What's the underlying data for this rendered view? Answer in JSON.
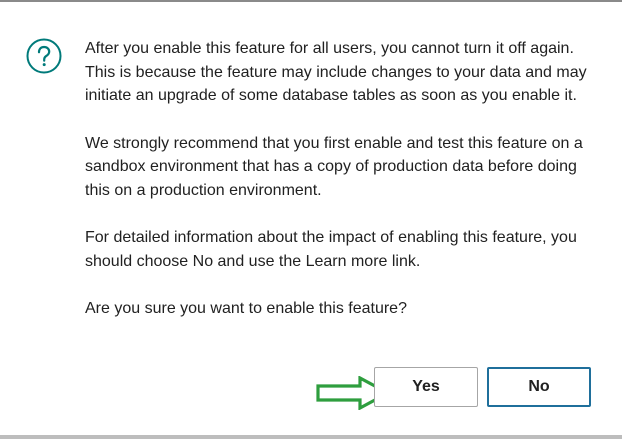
{
  "dialog": {
    "icon": "question-circle-icon",
    "icon_color": "#007a7a",
    "paragraphs": [
      "After you enable this feature for all users, you cannot turn it off again. This is because the feature may include changes to your data and may initiate an upgrade of some database tables as soon as you enable it.",
      "We strongly recommend that you first enable and test this feature on a sandbox environment that has a copy of production data before doing this on a production environment.",
      "For detailed information about the impact of enabling this feature, you should choose No and use the Learn more link.",
      "Are you sure you want to enable this feature?"
    ],
    "buttons": {
      "yes_label": "Yes",
      "no_label": "No"
    },
    "annotation": {
      "icon": "right-arrow-icon",
      "color": "#2e9e3e"
    }
  }
}
